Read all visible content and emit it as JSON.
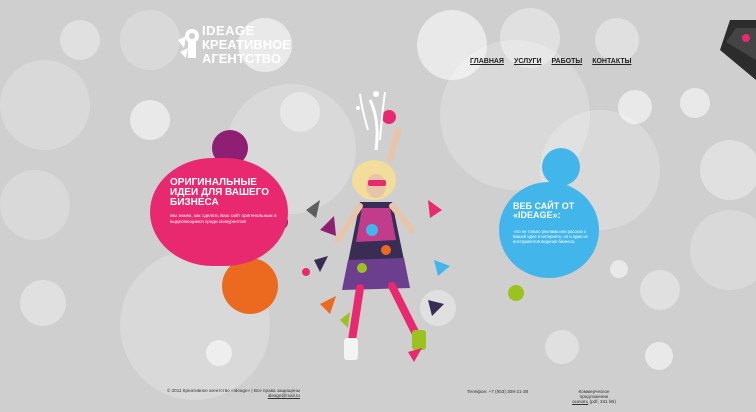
{
  "logo": {
    "line1": "IDEAGE",
    "line2": "КРЕАТИВНОЕ",
    "line3": "АГЕНТСТВО"
  },
  "nav": {
    "items": [
      "ГЛАВНАЯ",
      "УСЛУГИ",
      "РАБОТЫ",
      "КОНТАКТЫ"
    ]
  },
  "pink_card": {
    "title": "ОРИГИНАЛЬНЫЕ ИДЕИ ДЛЯ ВАШЕГО БИЗНЕСА",
    "body": "Мы знаем, как сделать Ваш сайт оригинальным и выделяющимся среди конкурентов!"
  },
  "blue_card": {
    "title": "ВЕБ САЙТ ОТ «IDEAGE»:",
    "body": "-это не только реклама или рассказ о Вашей идее в интернете, но и один из инструментов ведения бизнеса."
  },
  "footer": {
    "copyright": "© 2011 Креативное агентство «Ideage» | Все права защищены",
    "email": "ideage@mail.ru",
    "phone": "Телефон: +7 (953) 309-21-38",
    "offer_label": "Коммерческое предложение",
    "offer_link": "скачать",
    "offer_size": "(pdf, 341 kB)"
  },
  "colors": {
    "background": "#cfcfcf",
    "pink": "#e8296f",
    "blue": "#42b6ea",
    "orange": "#ec6a1f",
    "purple": "#8e1f72",
    "lime": "#9cc21f"
  }
}
